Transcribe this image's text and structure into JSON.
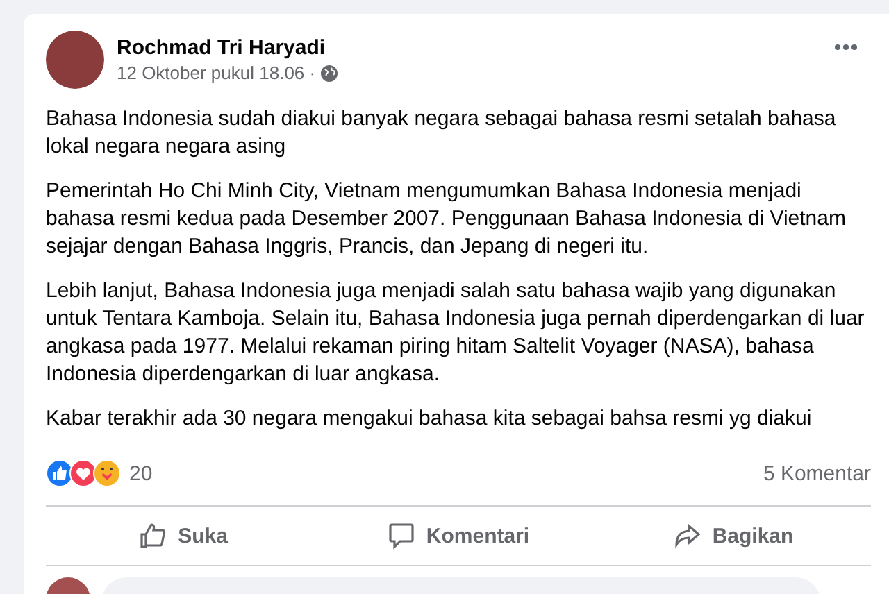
{
  "post": {
    "author": "Rochmad Tri Haryadi",
    "timestamp": "12 Oktober pukul 18.06 ·",
    "paragraphs": [
      "Bahasa Indonesia sudah diakui banyak negara sebagai bahasa resmi setalah bahasa lokal negara negara asing",
      "Pemerintah Ho Chi Minh City, Vietnam mengumumkan Bahasa Indonesia menjadi bahasa resmi kedua pada Desember 2007. Penggunaan Bahasa Indonesia di Vietnam sejajar dengan Bahasa Inggris, Prancis, dan Jepang di negeri itu.",
      "Lebih lanjut, Bahasa Indonesia juga menjadi salah satu bahasa wajib yang digunakan untuk Tentara Kamboja. Selain itu, Bahasa Indonesia juga pernah diperdengarkan di luar angkasa pada 1977. Melalui rekaman piring hitam Saltelit Voyager (NASA), bahasa Indonesia diperdengarkan di luar angkasa.",
      "Kabar terakhir ada 30 negara mengakui bahasa kita sebagai bahsa resmi yg diakui"
    ],
    "reaction_count": "20",
    "comment_count": "5 Komentar",
    "actions": [
      {
        "kind": "like",
        "label": "Suka"
      },
      {
        "kind": "comment",
        "label": "Komentari"
      },
      {
        "kind": "share",
        "label": "Bagikan"
      }
    ]
  }
}
